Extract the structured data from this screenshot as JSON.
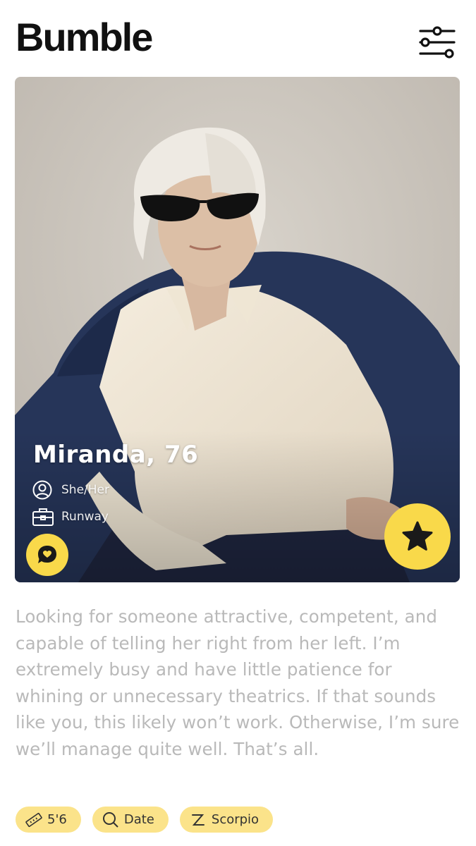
{
  "app": {
    "logo_text": "Bumble",
    "brand_color": "#F9D94A"
  },
  "header": {
    "filter_icon": "sliders-icon"
  },
  "profile": {
    "name_age": "Miranda, 76",
    "pronouns": "She/Her",
    "pronouns_icon": "user-icon",
    "job": "Runway",
    "job_icon": "briefcase-icon",
    "bio": "Looking for someone attractive, competent, and capable of telling her right from her left. I’m extremely busy and have little patience for whining or unnecessary theatrics. If that sounds like you, this likely won’t work. Otherwise, I’m sure we’ll manage quite well. That’s all.",
    "bio_color": "#b9b9b9"
  },
  "actions": {
    "compliment_icon": "compliment-chat-icon",
    "superswipe_icon": "star-icon"
  },
  "chips": [
    {
      "label": "5'6",
      "icon": "ruler-icon"
    },
    {
      "label": "Date",
      "icon": "search-icon"
    },
    {
      "label": "Scorpio",
      "icon": "zodiac-icon"
    }
  ]
}
